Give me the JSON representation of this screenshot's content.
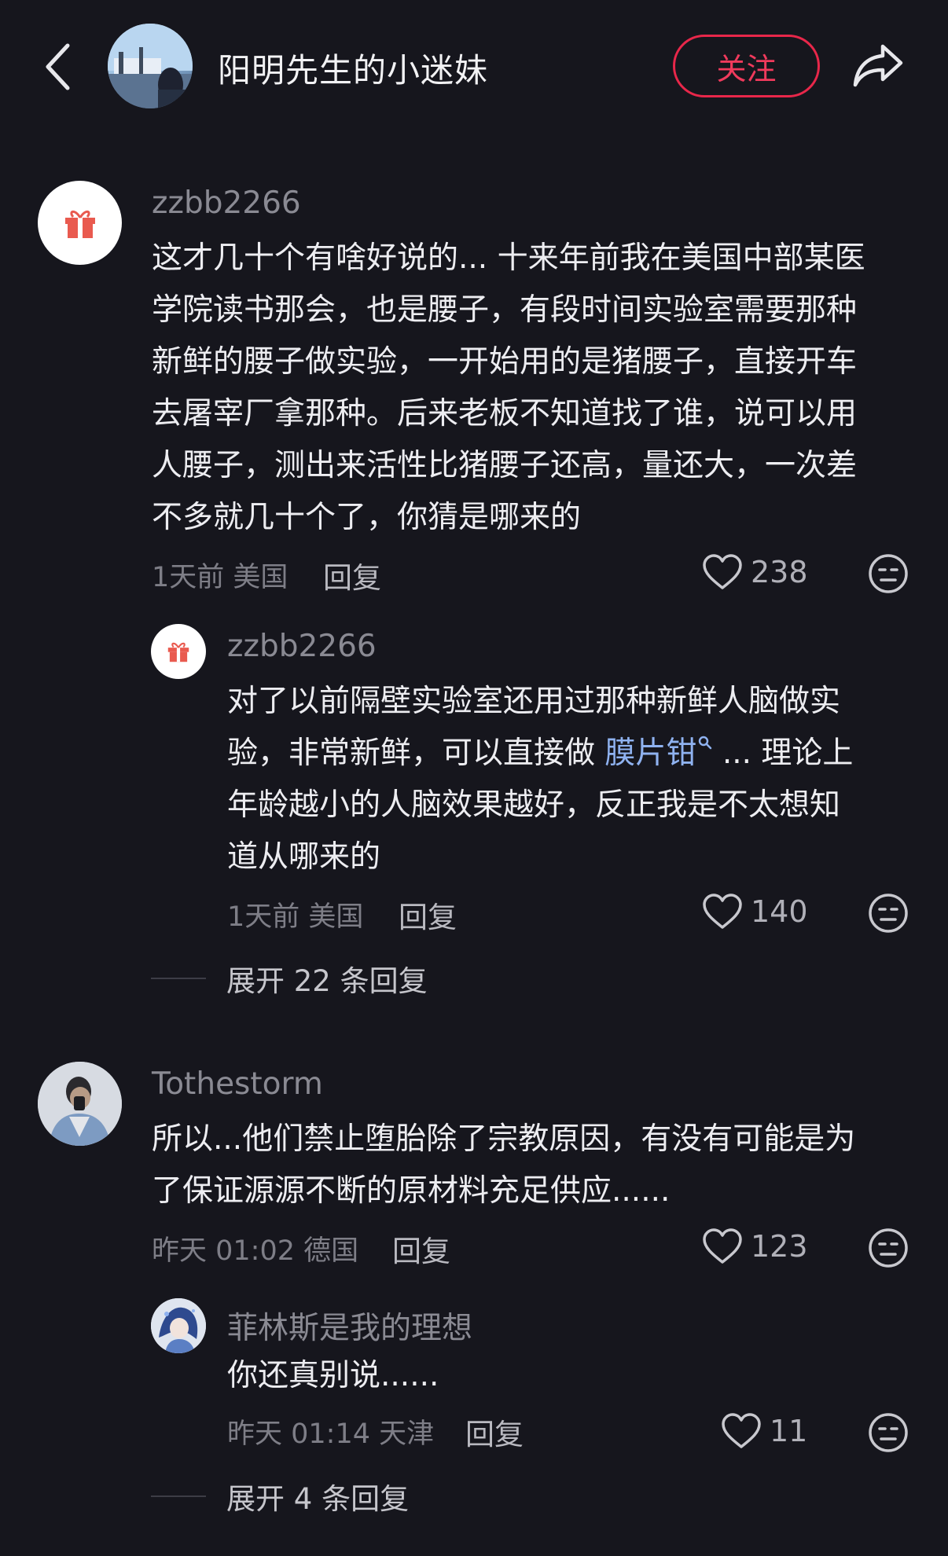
{
  "header": {
    "title": "阳明先生的小迷妹",
    "follow_label": "关注"
  },
  "colors": {
    "background": "#16161d",
    "accent": "#e8274a",
    "link": "#8fb2f0"
  },
  "comments": [
    {
      "username": "zzbb2266",
      "avatar": "gift-icon",
      "text": [
        "这才几十个有啥好说的... 十来年前我在美国中部某医",
        "学院读书那会，也是腰子，有段时间实验室需要那种",
        "新鲜的腰子做实验，一开始用的是猪腰子，直接开车",
        "去屠宰厂拿那种。后来老板不知道找了谁，说可以用",
        "人腰子，测出来活性比猪腰子还高，量还大，一次差",
        "不多就几十个了，你猜是哪来的"
      ],
      "meta": "1天前 美国",
      "reply": "回复",
      "likes": "238",
      "replies": [
        {
          "username": "zzbb2266",
          "avatar": "gift-icon",
          "text_line1": "对了以前隔壁实验室还用过那种新鲜人脑做实",
          "text_line2_pre": "验，非常新鲜，可以直接做 ",
          "text_line2_link": "膜片钳",
          "text_line2_post": " ... 理论上",
          "text_line3": "年龄越小的人脑效果越好，反正我是不太想知",
          "text_line4": "道从哪来的",
          "meta": "1天前 美国",
          "reply": "回复",
          "likes": "140"
        }
      ],
      "expand": "展开 22 条回复"
    },
    {
      "username": "Tothestorm",
      "avatar": "user-photo",
      "text": [
        "所以...他们禁止堕胎除了宗教原因，有没有可能是为",
        "了保证源源不断的原材料充足供应......"
      ],
      "meta": "昨天 01:02 德国",
      "reply": "回复",
      "likes": "123",
      "replies": [
        {
          "username": "菲林斯是我的理想",
          "avatar": "anime-avatar",
          "text": "你还真别说......",
          "meta": "昨天 01:14 天津",
          "reply": "回复",
          "likes": "11"
        }
      ],
      "expand": "展开 4 条回复"
    }
  ]
}
